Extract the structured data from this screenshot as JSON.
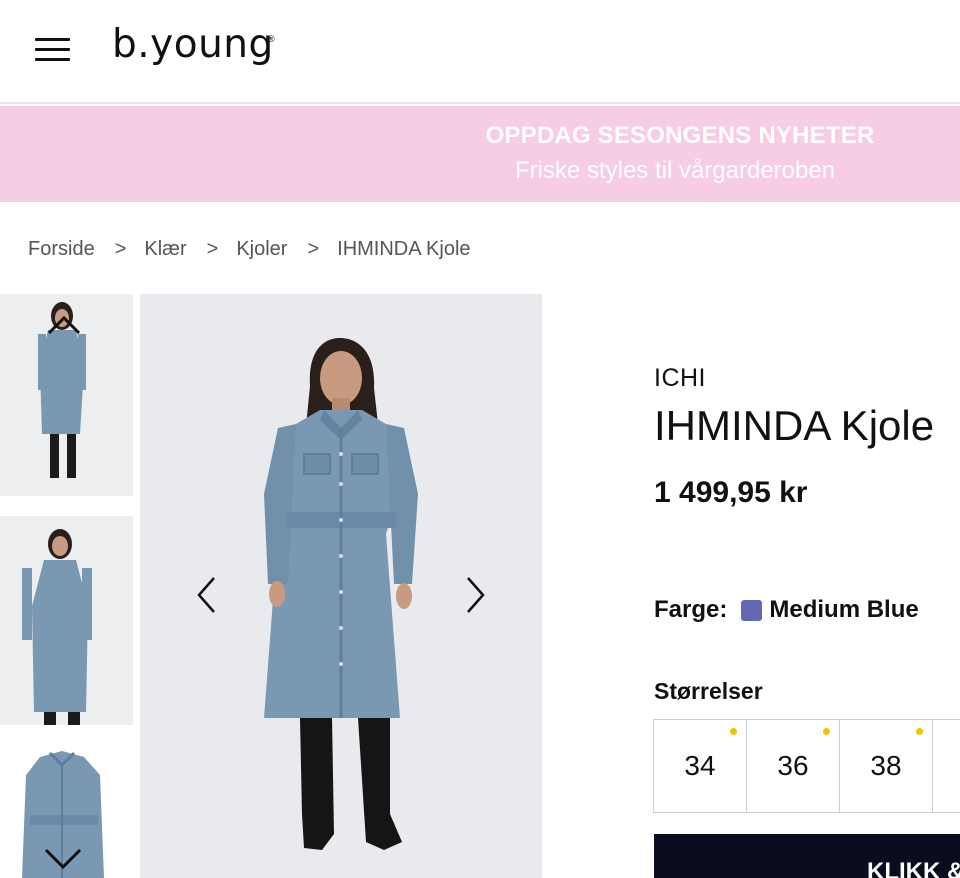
{
  "header": {
    "logo_text": "b.young",
    "logo_mark": "®",
    "menu_icon": "hamburger-menu-icon"
  },
  "promo": {
    "title": "OPPDAG SESONGENS NYHETER",
    "subtitle": "Friske styles til vårgarderoben",
    "background": "#f7cde6"
  },
  "breadcrumb": {
    "items": [
      "Forside",
      "Klær",
      "Kjoler",
      "IHMINDA Kjole"
    ],
    "separator": ">"
  },
  "gallery": {
    "thumbnail_count_visible": 3,
    "nav_icons": [
      "chevron-up-icon",
      "chevron-down-icon",
      "chevron-left-icon",
      "chevron-right-icon"
    ]
  },
  "product": {
    "brand": "ICHI",
    "title": "IHMINDA Kjole",
    "price": "1 499,95 kr",
    "color_label": "Farge:",
    "color_name": "Medium Blue",
    "color_hex": "#6468b4",
    "sizes_label": "Størrelser",
    "sizes": [
      "34",
      "36",
      "38"
    ],
    "cta_label": "KLIKK &"
  },
  "colors": {
    "low_stock_dot": "#f2c400",
    "cta_background": "#0a0d1f",
    "denim": "#7b98b3"
  }
}
